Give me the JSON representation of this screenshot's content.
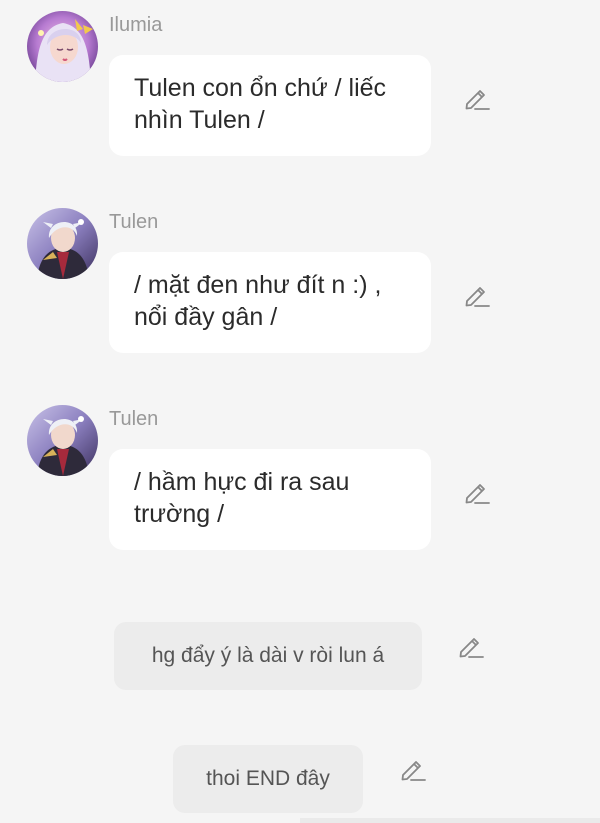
{
  "messages": [
    {
      "sender": "Ilumia",
      "avatar": "ilumia-avatar",
      "text_lines": [
        "Tulen con ổn chứ / liếc",
        "nhìn Tulen /"
      ]
    },
    {
      "sender": "Tulen",
      "avatar": "tulen-avatar",
      "text_lines": [
        "/ mặt đen như đít n :) ,",
        "nổi đầy gân /"
      ]
    },
    {
      "sender": "Tulen",
      "avatar": "tulen-avatar",
      "text_lines": [
        "/ hầm hực đi ra sau",
        "trường /"
      ]
    }
  ],
  "narration": [
    {
      "text": "hg đẩy ý là dài v ròi lun á"
    },
    {
      "text": "thoi END đây"
    }
  ],
  "icons": {
    "edit": "pencil-edit-icon"
  },
  "colors": {
    "background": "#f5f5f5",
    "bubble": "#ffffff",
    "narration_bubble": "#ececec",
    "name_text": "#999999",
    "message_text": "#2b2b2b",
    "narration_text": "#555555"
  }
}
